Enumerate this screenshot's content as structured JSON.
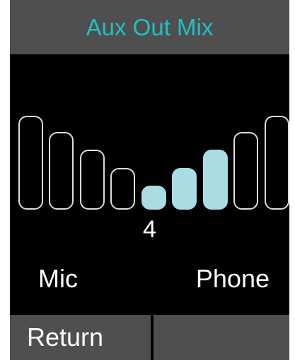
{
  "title": "Aux Out Mix",
  "mix": {
    "value": "4",
    "left_label": "Mic",
    "right_label": "Phone",
    "steps": 9,
    "selected_step": 4,
    "empty_color": "#dcdcdc",
    "fill_color": "#a9dce3"
  },
  "softkeys": {
    "left": "Return",
    "right": ""
  },
  "colors": {
    "title_text": "#1fc0c4",
    "bar_bg": "#4f4f4f",
    "screen_bg": "#000000"
  }
}
